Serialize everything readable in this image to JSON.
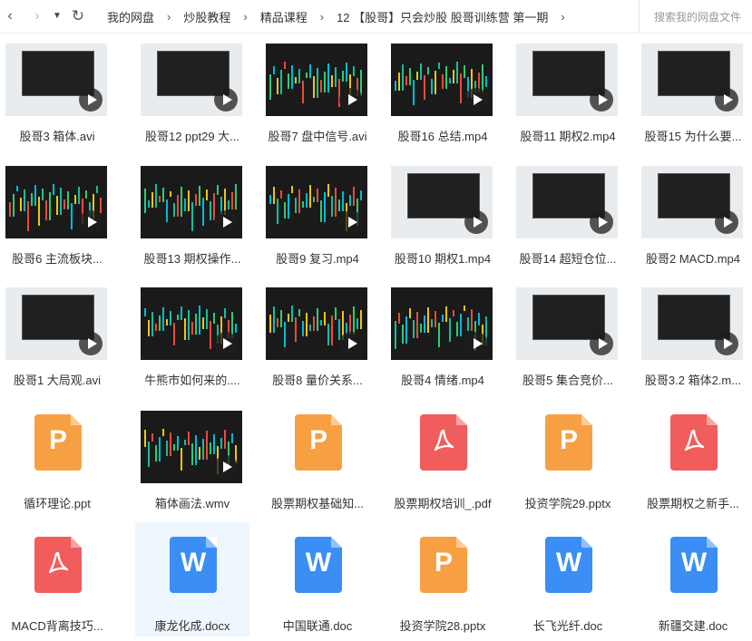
{
  "toolbar": {
    "back_icon": "chevron-left-icon",
    "forward_icon": "chevron-right-icon",
    "history_icon": "caret-down-icon",
    "refresh_icon": "refresh-icon",
    "search_placeholder": "搜索我的网盘文件"
  },
  "breadcrumb": [
    "我的网盘",
    "炒股教程",
    "精品课程",
    "12 【股哥】只会炒股 股哥训练营 第一期"
  ],
  "colors": {
    "ppt": "#f7a043",
    "pdf": "#f15c5c",
    "word": "#3a8ef6",
    "selected_bg": "#eef6fe"
  },
  "files": [
    {
      "name": "股哥3 箱体.avi",
      "kind": "video",
      "thumb": "dialog"
    },
    {
      "name": "股哥12 ppt29 大...",
      "kind": "video",
      "thumb": "dialog"
    },
    {
      "name": "股哥7 盘中信号.avi",
      "kind": "video",
      "thumb": "chart"
    },
    {
      "name": "股哥16 总结.mp4",
      "kind": "video",
      "thumb": "chart"
    },
    {
      "name": "股哥11 期权2.mp4",
      "kind": "video",
      "thumb": "dialog"
    },
    {
      "name": "股哥15 为什么要...",
      "kind": "video",
      "thumb": "dialog"
    },
    {
      "name": "股哥6 主流板块...",
      "kind": "video",
      "thumb": "chart"
    },
    {
      "name": "股哥13 期权操作...",
      "kind": "video",
      "thumb": "chart"
    },
    {
      "name": "股哥9 复习.mp4",
      "kind": "video",
      "thumb": "chart"
    },
    {
      "name": "股哥10 期权1.mp4",
      "kind": "video",
      "thumb": "dialog"
    },
    {
      "name": "股哥14 超短仓位...",
      "kind": "video",
      "thumb": "dialog"
    },
    {
      "name": "股哥2 MACD.mp4",
      "kind": "video",
      "thumb": "dialog"
    },
    {
      "name": "股哥1 大局观.avi",
      "kind": "video",
      "thumb": "dialog"
    },
    {
      "name": "牛熊市如何来的....",
      "kind": "video",
      "thumb": "chart"
    },
    {
      "name": "股哥8 量价关系...",
      "kind": "video",
      "thumb": "chart"
    },
    {
      "name": "股哥4 情绪.mp4",
      "kind": "video",
      "thumb": "chart"
    },
    {
      "name": "股哥5 集合竞价...",
      "kind": "video",
      "thumb": "dialog"
    },
    {
      "name": "股哥3.2 箱体2.m...",
      "kind": "video",
      "thumb": "dialog"
    },
    {
      "name": "循环理论.ppt",
      "kind": "ppt"
    },
    {
      "name": "箱体画法.wmv",
      "kind": "video",
      "thumb": "chart"
    },
    {
      "name": "股票期权基础知...",
      "kind": "ppt"
    },
    {
      "name": "股票期权培训_.pdf",
      "kind": "pdf"
    },
    {
      "name": "投资学院29.pptx",
      "kind": "ppt"
    },
    {
      "name": "股票期权之新手...",
      "kind": "pdf"
    },
    {
      "name": "MACD背离技巧...",
      "kind": "pdf"
    },
    {
      "name": "康龙化成.docx",
      "kind": "word",
      "selected": true
    },
    {
      "name": "中国联通.doc",
      "kind": "word"
    },
    {
      "name": "投资学院28.pptx",
      "kind": "ppt"
    },
    {
      "name": "长飞光纤.doc",
      "kind": "word"
    },
    {
      "name": "新疆交建.doc",
      "kind": "word"
    }
  ]
}
